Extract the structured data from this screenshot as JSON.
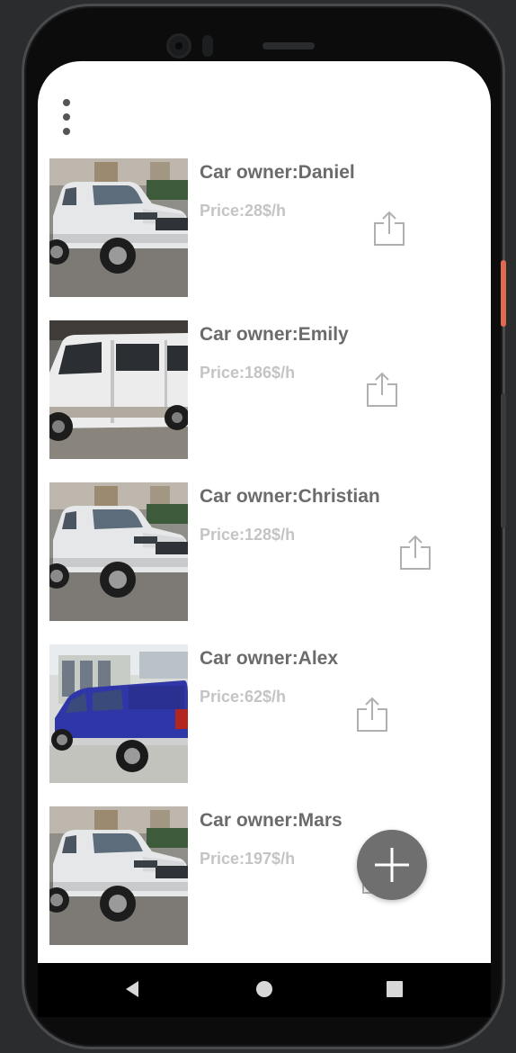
{
  "colors": {
    "owner_text": "#6b6b6b",
    "price_text": "#c4c4c4",
    "fab_background": "#6f6f6f",
    "menu_dots": "#555555",
    "share_icon": "#b0b0b0"
  },
  "header": {
    "menu_icon": "more-vert-icon"
  },
  "cars": [
    {
      "owner": "Car owner:Daniel",
      "price": "Price:28$/h",
      "photo": "white-pickup-truck-photo",
      "action_icon": "share-icon"
    },
    {
      "owner": "Car owner:Emily",
      "price": "Price:186$/h",
      "photo": "white-van-photo",
      "action_icon": "share-icon"
    },
    {
      "owner": "Car owner:Christian",
      "price": "Price:128$/h",
      "photo": "white-pickup-truck-photo",
      "action_icon": "share-icon"
    },
    {
      "owner": "Car owner:Alex",
      "price": "Price:62$/h",
      "photo": "blue-pickup-truck-photo",
      "action_icon": "share-icon"
    },
    {
      "owner": "Car owner:Mars",
      "price": "Price:197$/h",
      "photo": "white-pickup-truck-photo",
      "action_icon": "share-icon"
    }
  ],
  "fab": {
    "icon": "plus-icon"
  },
  "system_nav": {
    "back_icon": "back-triangle-icon",
    "home_icon": "home-circle-icon",
    "recents_icon": "recents-square-icon"
  }
}
